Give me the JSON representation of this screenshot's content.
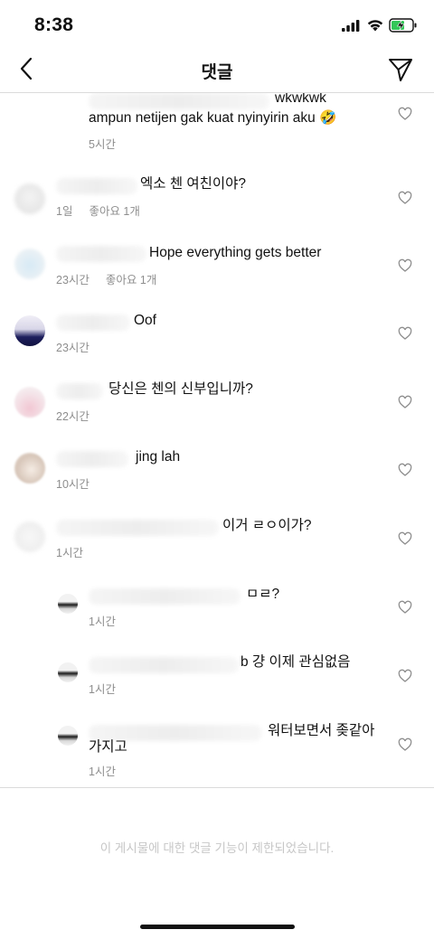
{
  "status_bar": {
    "time": "8:38"
  },
  "header": {
    "title": "댓글"
  },
  "comments": [
    {
      "text_line1": "wkwkwk",
      "text_line2": "ampun netijen gak kuat nyinyirin aku 🤣",
      "time": "5시간",
      "likes": ""
    },
    {
      "text": "엑소 첸 여친이야?",
      "time": "1일",
      "likes": "좋아요 1개"
    },
    {
      "text": "Hope everything gets better",
      "time": "23시간",
      "likes": "좋아요 1개"
    },
    {
      "text": "Oof",
      "time": "23시간",
      "likes": ""
    },
    {
      "text": "당신은 첸의 신부입니까?",
      "time": "22시간",
      "likes": ""
    },
    {
      "text": "jing lah",
      "time": "10시간",
      "likes": ""
    },
    {
      "text": "이거 ㄹㅇ이가?",
      "time": "1시간",
      "likes": ""
    },
    {
      "text": "ㅁㄹ?",
      "time": "1시간",
      "likes": ""
    },
    {
      "text": "b 걍 이제 관심없음",
      "time": "1시간",
      "likes": ""
    },
    {
      "text_line1": "워터보면서 좆같아",
      "text_line2": "가지고",
      "time": "1시간",
      "likes": ""
    }
  ],
  "footer": {
    "restricted_notice": "이 게시물에 대한 댓글 기능이 제한되었습니다."
  },
  "colors": {
    "secondary_text": "#8e8e8e",
    "divider": "#dbdbdb",
    "disabled_text": "#c7c7c7"
  },
  "icons": {
    "back": "chevron-left-icon",
    "send": "paper-plane-icon",
    "like": "heart-outline-icon"
  }
}
